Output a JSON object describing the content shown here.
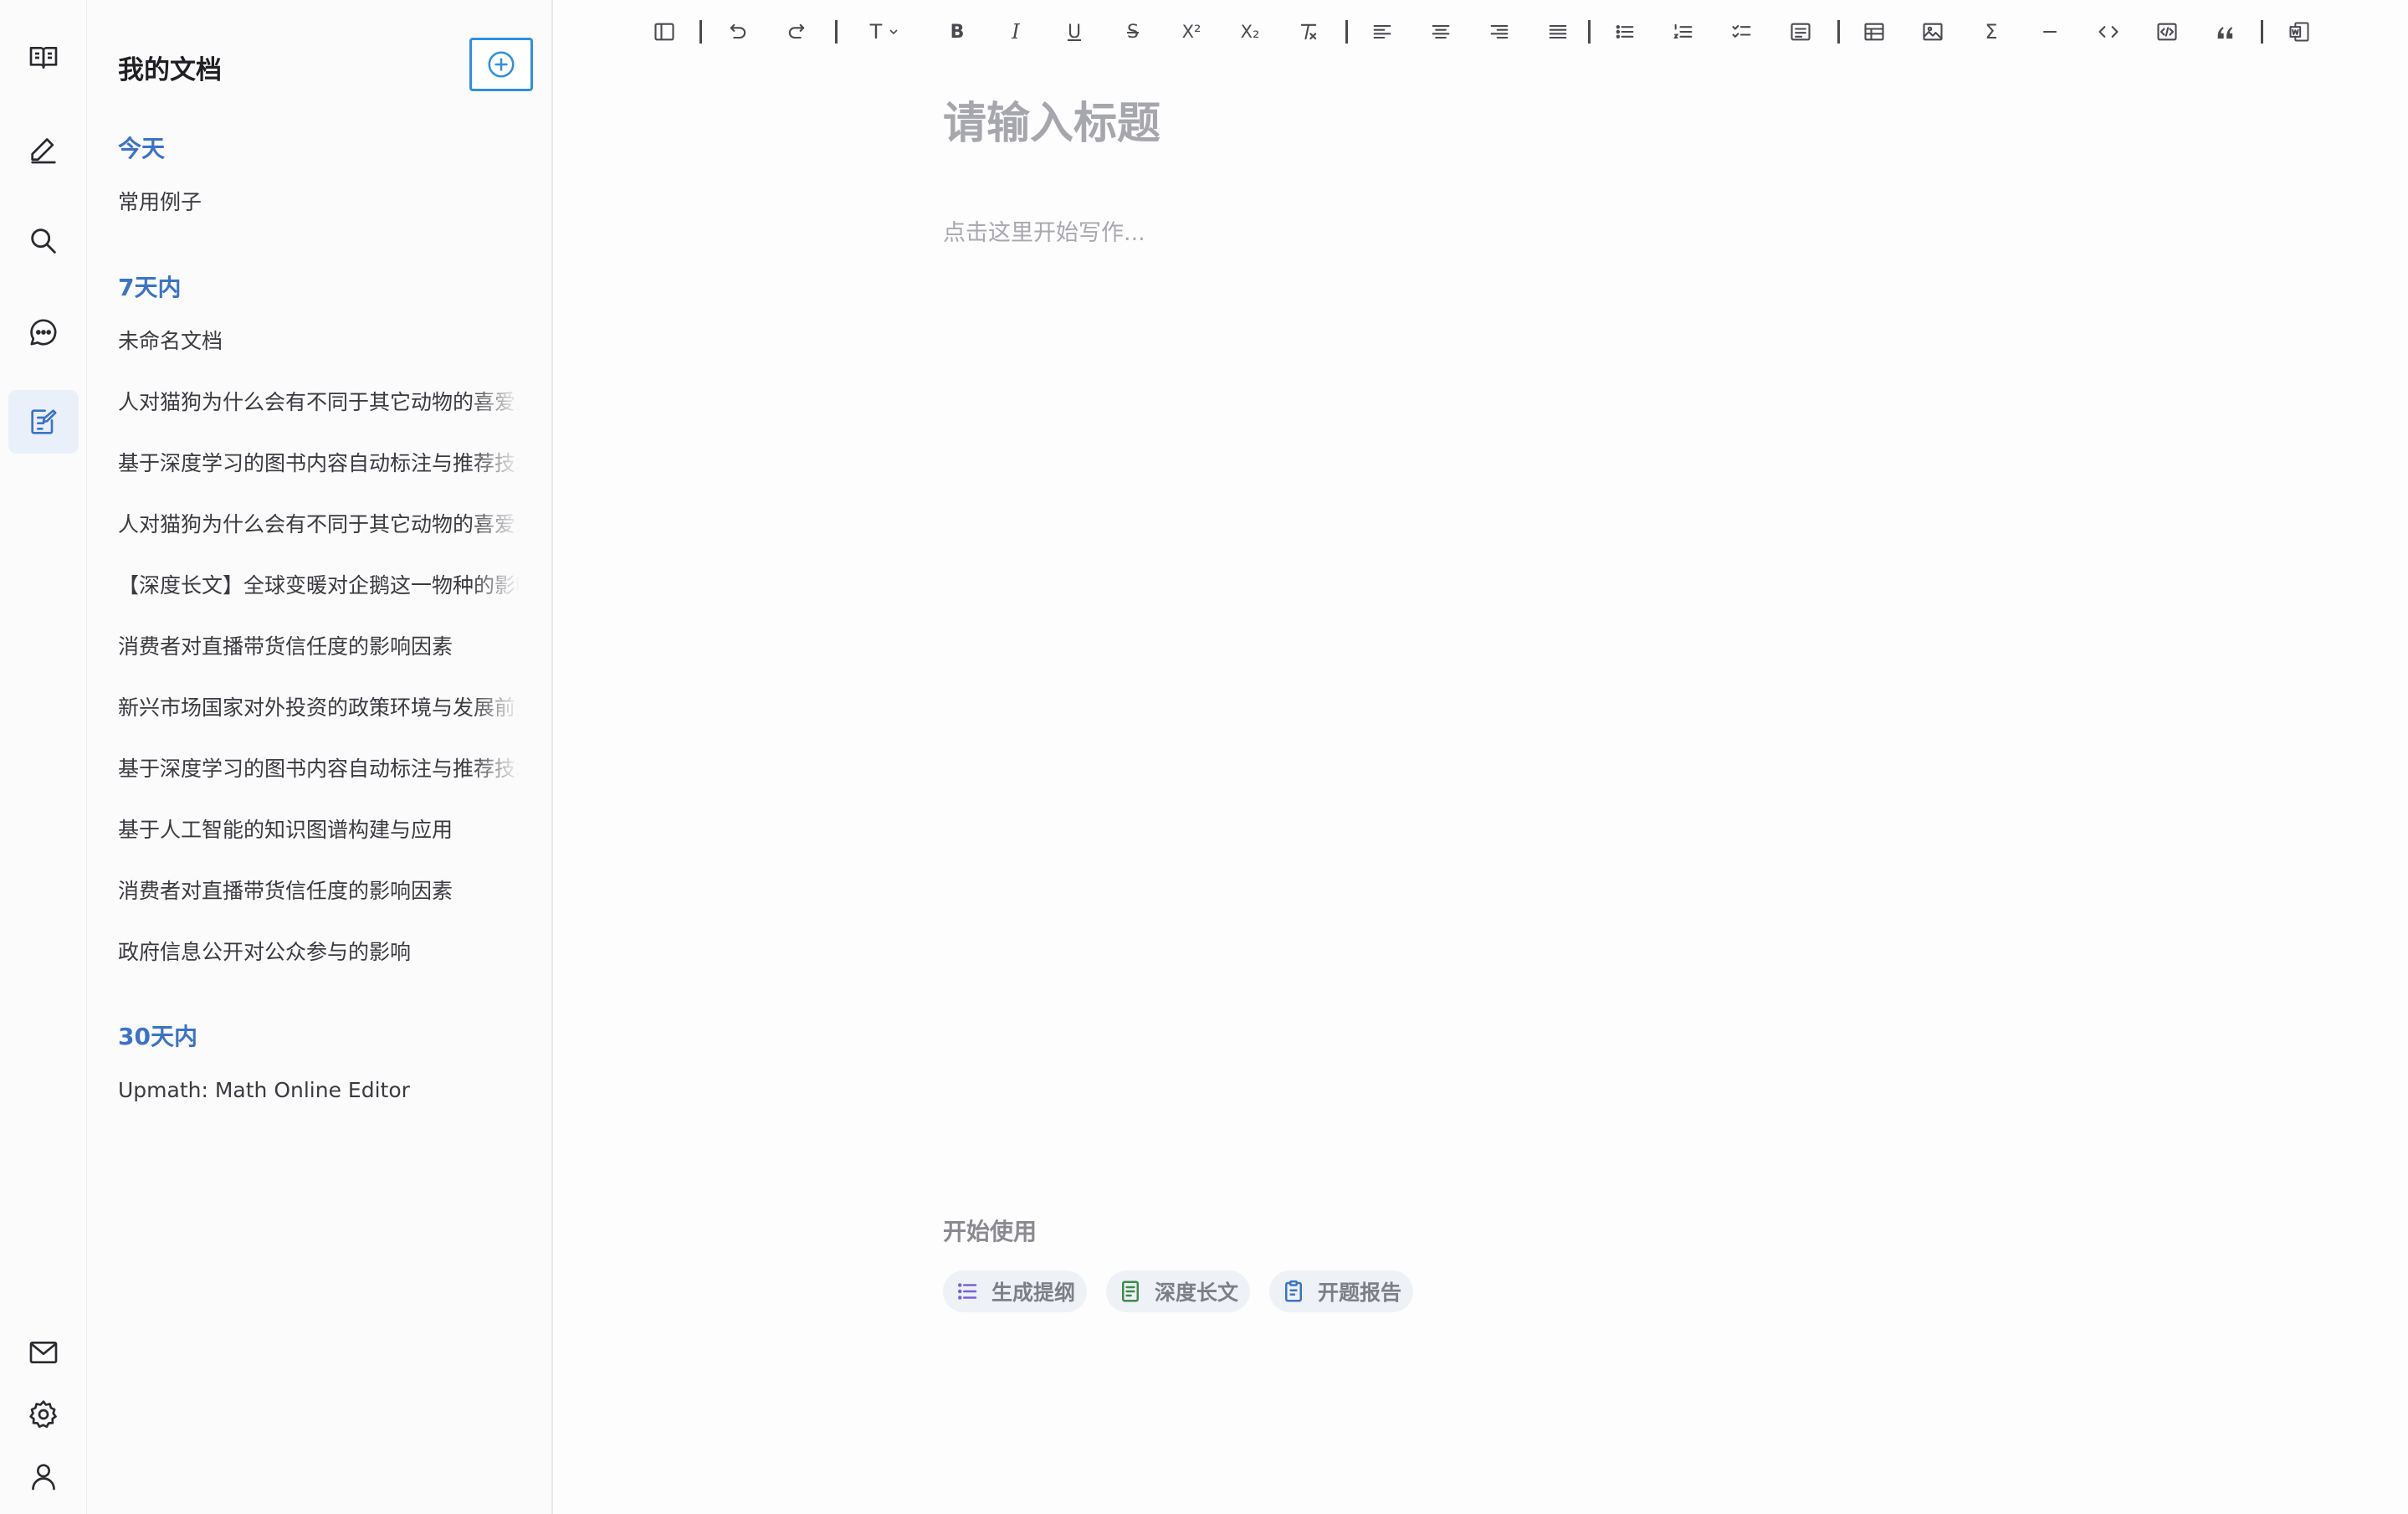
{
  "rail": {
    "items": [
      {
        "name": "rail-documents-icon"
      },
      {
        "name": "rail-write-icon"
      },
      {
        "name": "rail-search-icon"
      },
      {
        "name": "rail-chat-icon"
      },
      {
        "name": "rail-notes-icon",
        "active": true
      },
      {
        "name": "rail-mail-icon"
      },
      {
        "name": "rail-settings-icon"
      },
      {
        "name": "rail-user-icon"
      }
    ]
  },
  "sidebar": {
    "title": "我的文档",
    "new_doc_icon": "plus-circle-icon",
    "groups": [
      {
        "label": "今天",
        "docs": [
          "常用例子"
        ]
      },
      {
        "label": "7天内",
        "docs": [
          "未命名文档",
          "人对猫狗为什么会有不同于其它动物的喜爱之情",
          "基于深度学习的图书内容自动标注与推荐技术研究",
          "人对猫狗为什么会有不同于其它动物的喜爱之情",
          "【深度长文】全球变暖对企鹅这一物种的影响",
          "消费者对直播带货信任度的影响因素",
          "新兴市场国家对外投资的政策环境与发展前景",
          "基于深度学习的图书内容自动标注与推荐技术研究",
          "基于人工智能的知识图谱构建与应用",
          "消费者对直播带货信任度的影响因素",
          "政府信息公开对公众参与的影响"
        ]
      },
      {
        "label": "30天内",
        "docs": [
          "Upmath: Math Online Editor"
        ]
      }
    ]
  },
  "toolbar": {
    "buttons": [
      "sidebar-toggle-icon",
      "undo-icon",
      "redo-icon",
      "text-style-icon",
      "bold-icon",
      "italic-icon",
      "underline-icon",
      "strikethrough-icon",
      "superscript-icon",
      "subscript-icon",
      "clear-format-icon",
      "align-left-icon",
      "align-center-icon",
      "align-right-icon",
      "align-justify-icon",
      "bullet-list-icon",
      "ordered-list-icon",
      "task-list-icon",
      "outline-icon",
      "table-icon",
      "image-icon",
      "formula-icon",
      "horizontal-rule-icon",
      "inline-code-icon",
      "code-block-icon",
      "quote-icon",
      "export-word-icon"
    ],
    "text_style_label": "T",
    "bold_label": "B",
    "italic_label": "I",
    "underline_label": "U",
    "strike_label": "S",
    "superscript_label": "X²",
    "subscript_label": "X₂",
    "formula_label": "Σ"
  },
  "editor": {
    "title_placeholder": "请输入标题",
    "body_placeholder": "点击这里开始写作...",
    "start_label": "开始使用",
    "chips": [
      {
        "label": "生成提纲",
        "icon": "list-icon",
        "color": "#7b5fe0"
      },
      {
        "label": "深度长文",
        "icon": "article-icon",
        "color": "#3f8a4a"
      },
      {
        "label": "开题报告",
        "icon": "clipboard-icon",
        "color": "#3b73c8"
      }
    ]
  },
  "colors": {
    "accent": "#3b73c8",
    "new_button_border": "#2f8fe3",
    "active_rail_bg": "#eaf0f9"
  }
}
